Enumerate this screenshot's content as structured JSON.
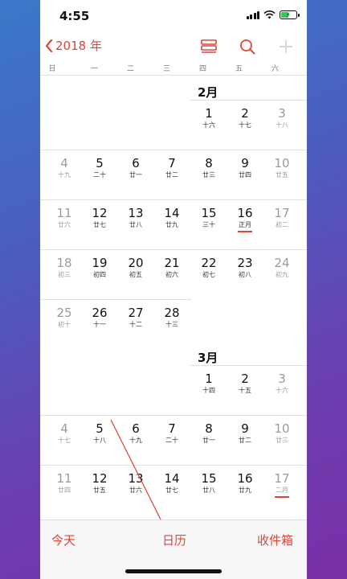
{
  "status": {
    "time": "4:55"
  },
  "nav": {
    "back_label": "2018 年"
  },
  "weekdays": [
    "日",
    "一",
    "二",
    "三",
    "四",
    "五",
    "六"
  ],
  "months": [
    {
      "title": "2月",
      "weeks": [
        [
          null,
          null,
          null,
          null,
          {
            "day": "1",
            "lunar": "十六"
          },
          {
            "day": "2",
            "lunar": "十七"
          },
          {
            "day": "3",
            "lunar": "十八"
          }
        ],
        [
          {
            "day": "4",
            "lunar": "十九"
          },
          {
            "day": "5",
            "lunar": "二十"
          },
          {
            "day": "6",
            "lunar": "廿一"
          },
          {
            "day": "7",
            "lunar": "廿二"
          },
          {
            "day": "8",
            "lunar": "廿三"
          },
          {
            "day": "9",
            "lunar": "廿四"
          },
          {
            "day": "10",
            "lunar": "廿五"
          }
        ],
        [
          {
            "day": "11",
            "lunar": "廿六"
          },
          {
            "day": "12",
            "lunar": "廿七"
          },
          {
            "day": "13",
            "lunar": "廿八"
          },
          {
            "day": "14",
            "lunar": "廿九"
          },
          {
            "day": "15",
            "lunar": "三十"
          },
          {
            "day": "16",
            "lunar": "正月",
            "mark": true
          },
          {
            "day": "17",
            "lunar": "初二"
          }
        ],
        [
          {
            "day": "18",
            "lunar": "初三"
          },
          {
            "day": "19",
            "lunar": "初四"
          },
          {
            "day": "20",
            "lunar": "初五"
          },
          {
            "day": "21",
            "lunar": "初六"
          },
          {
            "day": "22",
            "lunar": "初七"
          },
          {
            "day": "23",
            "lunar": "初八"
          },
          {
            "day": "24",
            "lunar": "初九"
          }
        ],
        [
          {
            "day": "25",
            "lunar": "初十"
          },
          {
            "day": "26",
            "lunar": "十一"
          },
          {
            "day": "27",
            "lunar": "十二"
          },
          {
            "day": "28",
            "lunar": "十三"
          },
          null,
          null,
          null
        ]
      ]
    },
    {
      "title": "3月",
      "weeks": [
        [
          null,
          null,
          null,
          null,
          {
            "day": "1",
            "lunar": "十四"
          },
          {
            "day": "2",
            "lunar": "十五"
          },
          {
            "day": "3",
            "lunar": "十六"
          }
        ],
        [
          {
            "day": "4",
            "lunar": "十七"
          },
          {
            "day": "5",
            "lunar": "十八"
          },
          {
            "day": "6",
            "lunar": "十九"
          },
          {
            "day": "7",
            "lunar": "二十"
          },
          {
            "day": "8",
            "lunar": "廿一"
          },
          {
            "day": "9",
            "lunar": "廿二"
          },
          {
            "day": "10",
            "lunar": "廿三"
          }
        ],
        [
          {
            "day": "11",
            "lunar": "廿四"
          },
          {
            "day": "12",
            "lunar": "廿五"
          },
          {
            "day": "13",
            "lunar": "廿六"
          },
          {
            "day": "14",
            "lunar": "廿七"
          },
          {
            "day": "15",
            "lunar": "廿八"
          },
          {
            "day": "16",
            "lunar": "廿九"
          },
          {
            "day": "17",
            "lunar": "二月",
            "mark": true
          }
        ]
      ]
    }
  ],
  "tabs": {
    "today": "今天",
    "calendars": "日历",
    "inbox": "收件箱"
  },
  "colors": {
    "accent": "#d9473b",
    "weekend": "#9a9a9a"
  }
}
